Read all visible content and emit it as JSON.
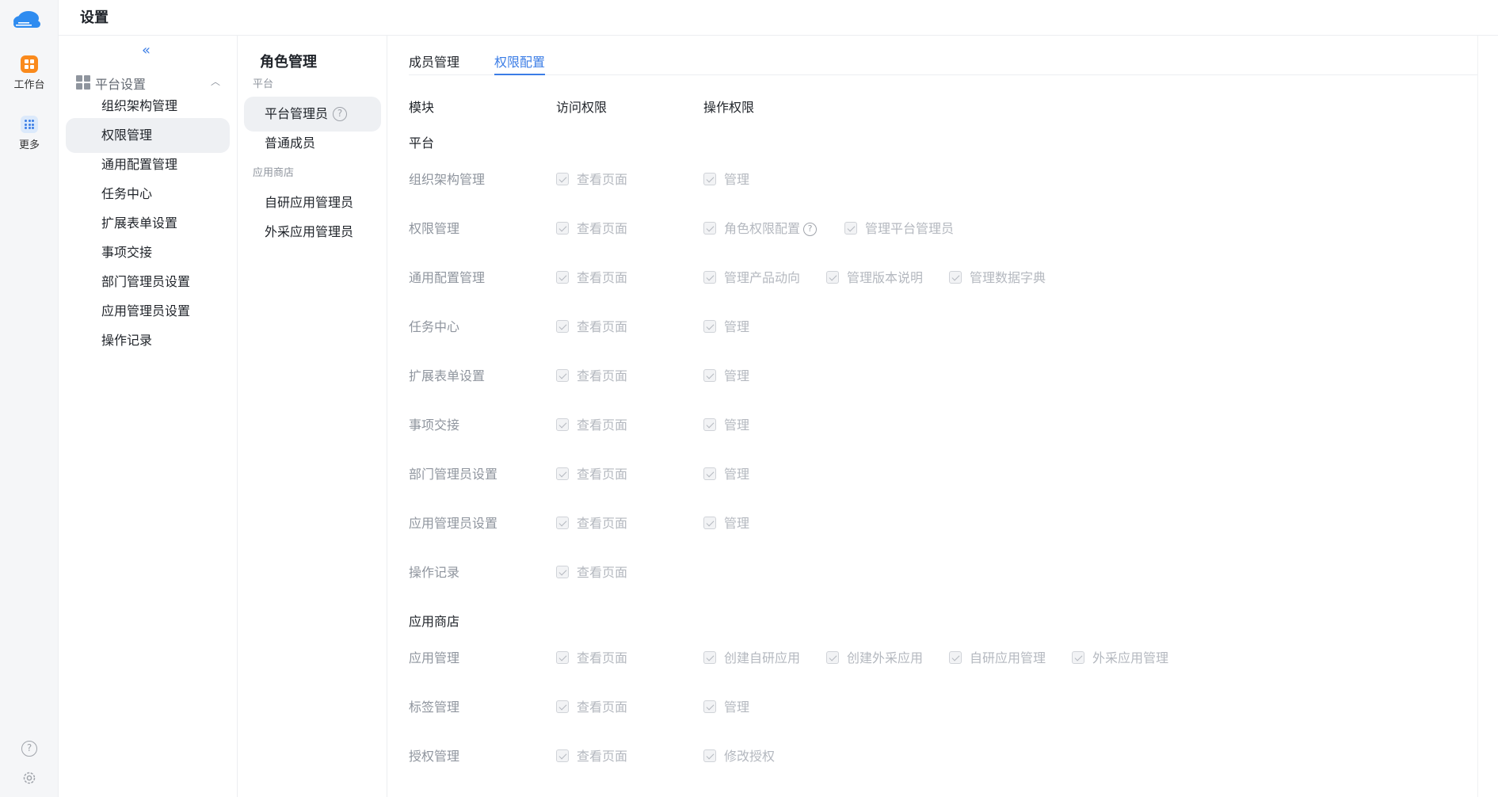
{
  "app": {
    "header_title": "设置"
  },
  "rail": {
    "workbench": "工作台",
    "more": "更多",
    "colors": {
      "workbench_icon": "#fa8a1c",
      "more_icon_bg": "#dbe9fb",
      "logo": "#2f8cf0"
    }
  },
  "menu": {
    "collapse_glyph": "«",
    "group_label": "平台设置",
    "items": [
      {
        "label": "组织架构管理"
      },
      {
        "label": "权限管理"
      },
      {
        "label": "通用配置管理"
      },
      {
        "label": "任务中心"
      },
      {
        "label": "扩展表单设置"
      },
      {
        "label": "事项交接"
      },
      {
        "label": "部门管理员设置"
      },
      {
        "label": "应用管理员设置"
      },
      {
        "label": "操作记录"
      }
    ],
    "active_item": "权限管理"
  },
  "roles": {
    "title": "角色管理",
    "section_platform": "平台",
    "section_store": "应用商店",
    "items": {
      "platform_admin": "平台管理员",
      "normal_member": "普通成员",
      "self_dev_admin": "自研应用管理员",
      "external_admin": "外采应用管理员"
    },
    "active_item": "平台管理员"
  },
  "content": {
    "tabs": {
      "members": "成员管理",
      "permissions": "权限配置"
    },
    "active_tab": "权限配置",
    "columns": {
      "module": "模块",
      "access": "访问权限",
      "operation": "操作权限"
    },
    "sections": {
      "platform": "平台",
      "store": "应用商店"
    },
    "view_page": "查看页面",
    "rows": [
      {
        "module": "组织架构管理",
        "ops": [
          "管理"
        ]
      },
      {
        "module": "权限管理",
        "ops": [
          "角色权限配置",
          "管理平台管理员"
        ]
      },
      {
        "module": "通用配置管理",
        "ops": [
          "管理产品动向",
          "管理版本说明",
          "管理数据字典"
        ]
      },
      {
        "module": "任务中心",
        "ops": [
          "管理"
        ]
      },
      {
        "module": "扩展表单设置",
        "ops": [
          "管理"
        ]
      },
      {
        "module": "事项交接",
        "ops": [
          "管理"
        ]
      },
      {
        "module": "部门管理员设置",
        "ops": [
          "管理"
        ]
      },
      {
        "module": "应用管理员设置",
        "ops": [
          "管理"
        ]
      },
      {
        "module": "操作记录",
        "ops": []
      }
    ],
    "store_rows": [
      {
        "module": "应用管理",
        "ops": [
          "创建自研应用",
          "创建外采应用",
          "自研应用管理",
          "外采应用管理"
        ]
      },
      {
        "module": "标签管理",
        "ops": [
          "管理"
        ]
      },
      {
        "module": "授权管理",
        "ops": [
          "修改授权"
        ]
      }
    ],
    "accent_color": "#3b7de6"
  }
}
